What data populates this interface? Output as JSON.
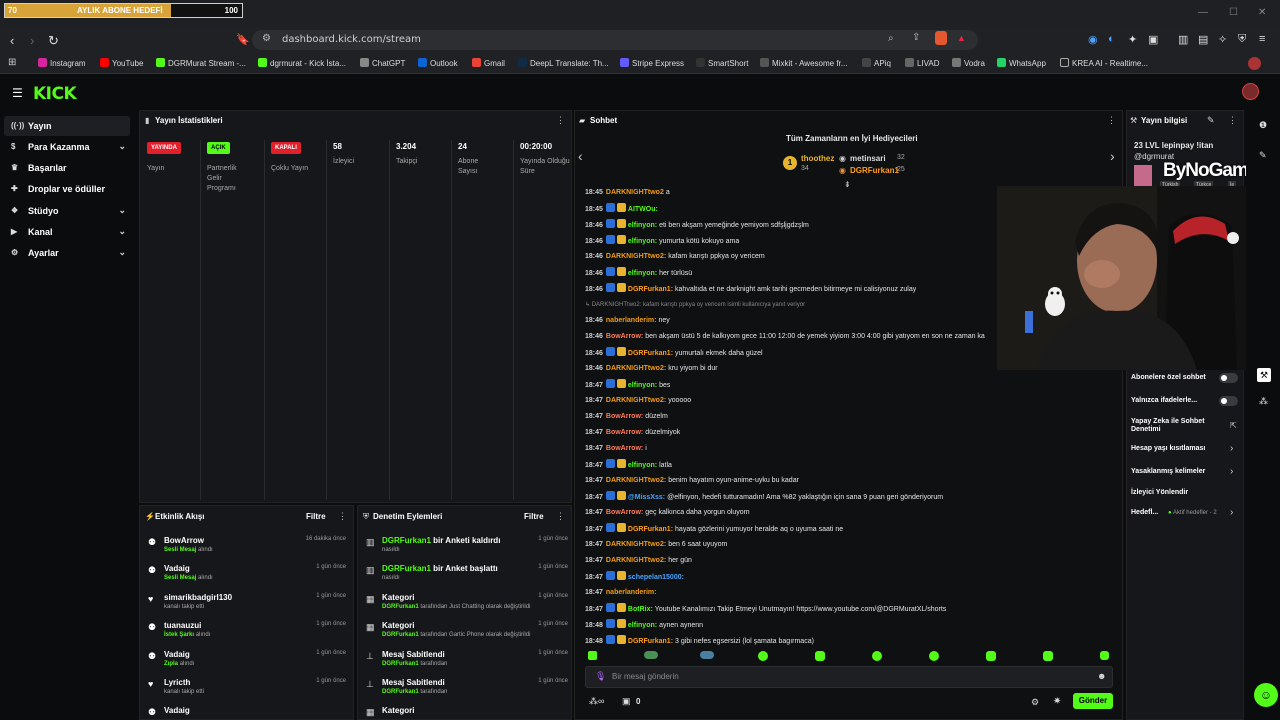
{
  "goal": {
    "start": "70",
    "title": "AYLIK ABONE HEDEFİ",
    "end": "100",
    "progress": 0.7,
    "fill_color": "#d8a43a"
  },
  "browser": {
    "url": "dashboard.kick.com/stream",
    "bookmarks": [
      "Instagram",
      "YouTube",
      "DGRMurat Stream -...",
      "dgrmurat - Kick İsta...",
      "ChatGPT",
      "Outlook",
      "Gmail",
      "DeepL Translate: Th...",
      "Stripe Express",
      "SmartShort",
      "Mixkit - Awesome fr...",
      "APiq",
      "LIVAD",
      "Vodra",
      "WhatsApp",
      "KREA AI - Realtime..."
    ]
  },
  "brand": {
    "logo": "KICK",
    "accent": "#53fc18"
  },
  "sidebar": {
    "items": [
      {
        "label": "Yayın",
        "icon": "broadcast-icon",
        "active": true
      },
      {
        "label": "Para Kazanma",
        "icon": "dollar-icon",
        "chevron": true
      },
      {
        "label": "Başarılar",
        "icon": "trophy-icon"
      },
      {
        "label": "Droplar ve ödüller",
        "icon": "gift-icon"
      },
      {
        "label": "Stüdyo",
        "icon": "studio-icon",
        "chevron": true
      },
      {
        "label": "Kanal",
        "icon": "channel-icon",
        "chevron": true
      },
      {
        "label": "Ayarlar",
        "icon": "gear-icon",
        "chevron": true
      }
    ]
  },
  "stats": {
    "title": "Yayın İstatistikleri",
    "cells": [
      {
        "badge": "YAYINDA",
        "badge_color": "#e2202b",
        "label": "Yayın"
      },
      {
        "badge": "AÇIK",
        "badge_color": "#53fc18",
        "label": "Partnerlik Gelir Programı"
      },
      {
        "badge": "KAPALI",
        "badge_color": "#e2202b",
        "label": "Çoklu Yayın"
      },
      {
        "value": "58",
        "label": "İzleyici"
      },
      {
        "value": "3.204",
        "label": "Takipçi"
      },
      {
        "value": "24",
        "label": "Abone Sayısı"
      },
      {
        "value": "00:20:00",
        "label": "Yayında Olduğu Süre"
      }
    ]
  },
  "activity": {
    "title": "Etkinlik Akışı",
    "filter": "Filtre",
    "items": [
      {
        "name": "BowArrow",
        "action": "Sesli Mesaj",
        "suffix": "alındı",
        "time": "16 dakika önce"
      },
      {
        "name": "Vadaig",
        "action": "Sesli Mesaj",
        "suffix": "alındı",
        "time": "1 gün önce"
      },
      {
        "name": "simarikbadgirl130",
        "action": "",
        "suffix": "kanalı takip etti",
        "time": "1 gün önce"
      },
      {
        "name": "tuanauzui",
        "action": "İstek Şarkı",
        "suffix": "alındı",
        "time": "1 gün önce"
      },
      {
        "name": "Vadaig",
        "action": "Zıpla",
        "suffix": "alındı",
        "time": "1 gün önce"
      },
      {
        "name": "Lyricth",
        "action": "",
        "suffix": "kanalı takip etti",
        "time": "1 gün önce"
      },
      {
        "name": "Vadaig",
        "action": "",
        "suffix": "",
        "time": ""
      }
    ]
  },
  "moderation": {
    "title": "Denetim Eylemleri",
    "filter": "Filtre",
    "items": [
      {
        "actor": "DGRFurkan1",
        "title": "bir Anketi kaldırdı",
        "sub_actor": "",
        "sub": "nasıldı",
        "time": "1 gün önce"
      },
      {
        "actor": "DGRFurkan1",
        "title": "bir Anket başlattı",
        "sub_actor": "",
        "sub": "nasıldı",
        "time": "1 gün önce"
      },
      {
        "actor": "",
        "title": "Kategori",
        "sub_actor": "DGRFurkan1",
        "sub": "tarafından Just Chatting olarak değiştirildi",
        "time": "1 gün önce"
      },
      {
        "actor": "",
        "title": "Kategori",
        "sub_actor": "DGRFurkan1",
        "sub": "tarafından Gartic Phone olarak değiştirildi",
        "time": "1 gün önce"
      },
      {
        "actor": "",
        "title": "Mesaj Sabitlendi",
        "sub_actor": "DGRFurkan1",
        "sub": "tarafından",
        "time": "1 gün önce"
      },
      {
        "actor": "",
        "title": "Mesaj Sabitlendi",
        "sub_actor": "DGRFurkan1",
        "sub": "tarafından",
        "time": "1 gün önce"
      },
      {
        "actor": "",
        "title": "Kategori",
        "sub_actor": "",
        "sub": "",
        "time": ""
      }
    ]
  },
  "chat": {
    "title": "Sohbet",
    "gifters_title": "Tüm Zamanların en İyi Hediyecileri",
    "gifters": [
      {
        "name": "thoothez",
        "count": "34"
      },
      {
        "name": "metinsari",
        "count": "32"
      },
      {
        "name": "DGRFurkan1",
        "count": "25"
      }
    ],
    "messages": [
      {
        "t": "18:45",
        "u": "DARKNIGHTtwo2",
        "c": "#f39c12",
        "m": "a"
      },
      {
        "t": "18:45",
        "u": "AITWOu:",
        "c": "#53fc18",
        "m": ""
      },
      {
        "t": "18:46",
        "u": "elfinyon:",
        "c": "#53fc18",
        "m": "eti ben akşam yemeğinde yemiyom sdfşljgdzşlm"
      },
      {
        "t": "18:46",
        "u": "elfinyon:",
        "c": "#53fc18",
        "m": "yumurta kötü kokuyo ama"
      },
      {
        "t": "18:46",
        "u": "DARKNIGHTtwo2:",
        "c": "#f39c12",
        "m": "kafam karıştı ppkya oy vericem"
      },
      {
        "t": "18:46",
        "u": "elfinyon:",
        "c": "#53fc18",
        "m": "her türlüsü"
      },
      {
        "t": "18:46",
        "u": "DGRFurkan1:",
        "c": "#ff9f1c",
        "m": "kahvaltıda et ne darknight amk tarihi gecmeden bitirmeye mi calisiyonuz zulay"
      },
      {
        "t": "",
        "u": "",
        "c": "#888",
        "m": "↳ DARKNIGHTtwo2: kafam karıştı ppkya oy vericem isimli kullanıcıya yanıt veriyor",
        "reply": true
      },
      {
        "t": "18:46",
        "u": "naberlanderim:",
        "c": "#f39c12",
        "m": "ney"
      },
      {
        "t": "18:46",
        "u": "BowArrow:",
        "c": "#ff7a5c",
        "m": "ben akşam üstü 5 de kalkıyom gece 11:00 12:00 de yemek yiyiom 3:00 4:00 gibi yatıyom en son ne zaman ka"
      },
      {
        "t": "18:46",
        "u": "DGRFurkan1:",
        "c": "#ff9f1c",
        "m": "yumurtalı ekmek daha güzel"
      },
      {
        "t": "18:46",
        "u": "DARKNIGHTtwo2:",
        "c": "#f39c12",
        "m": "kru yiyom bi dur"
      },
      {
        "t": "18:47",
        "u": "elfinyon:",
        "c": "#53fc18",
        "m": "bes"
      },
      {
        "t": "18:47",
        "u": "DARKNIGHTtwo2:",
        "c": "#f39c12",
        "m": "yooooo"
      },
      {
        "t": "18:47",
        "u": "BowArrow:",
        "c": "#ff7a5c",
        "m": "düzelm"
      },
      {
        "t": "18:47",
        "u": "BowArrow:",
        "c": "#ff7a5c",
        "m": "düzelmiyok"
      },
      {
        "t": "18:47",
        "u": "BowArrow:",
        "c": "#ff7a5c",
        "m": "i"
      },
      {
        "t": "18:47",
        "u": "elfinyon:",
        "c": "#53fc18",
        "m": "latla"
      },
      {
        "t": "18:47",
        "u": "DARKNIGHTtwo2:",
        "c": "#f39c12",
        "m": "benim hayatım oyun-anime-uyku bu kadar"
      },
      {
        "t": "18:47",
        "u": "@MissXss:",
        "c": "#4aa3ff",
        "m": "@elfinyon, hedefi tutturamadın! Ama %82 yaklaştığın için sana 9 puan geri gönderiyorum"
      },
      {
        "t": "18:47",
        "u": "BowArrow:",
        "c": "#ff7a5c",
        "m": "geç kalkınca daha yorgun oluyom"
      },
      {
        "t": "18:47",
        "u": "DGRFurkan1:",
        "c": "#ff9f1c",
        "m": "hayata gözlerini yumuyor heralde aq o uyuma saati ne"
      },
      {
        "t": "18:47",
        "u": "DARKNIGHTtwo2:",
        "c": "#f39c12",
        "m": "ben 6 saat uyuyom"
      },
      {
        "t": "18:47",
        "u": "DARKNIGHTtwo2:",
        "c": "#f39c12",
        "m": "her gün"
      },
      {
        "t": "18:47",
        "u": "schepelan15000:",
        "c": "#4aa3ff",
        "m": ""
      },
      {
        "t": "18:47",
        "u": "naberlanderim:",
        "c": "#f39c12",
        "m": ""
      },
      {
        "t": "18:47",
        "u": "BotRix:",
        "c": "#53fc18",
        "m": "Youtube Kanalımızı Takip Etmeyi Unutmayın! https://www.youtube.com/@DGRMuratXL/shorts"
      },
      {
        "t": "18:48",
        "u": "elfinyon:",
        "c": "#53fc18",
        "m": "aynen aynenn"
      },
      {
        "t": "18:48",
        "u": "DGRFurkan1:",
        "c": "#ff9f1c",
        "m": "3 gibi nefes egsersizi (lol şamata bagırmaca)"
      }
    ],
    "input_placeholder": "Bir mesaj gönderin",
    "points": "0",
    "send": "Gönder"
  },
  "info": {
    "title": "Yayın bilgisi",
    "stream_title": "23 LVL lepinpay !itan",
    "handle": "@dgrmurat",
    "tags": [
      "Türkish",
      "Türkçe",
      "İe"
    ],
    "watermark": "ByNoGame",
    "rows": [
      {
        "label": "Abonelere özel sohbet",
        "type": "toggle"
      },
      {
        "label": "Yalnızca ifadelerle...",
        "type": "toggle"
      },
      {
        "label": "Yapay Zeka ile Sohbet Denetimi",
        "type": "link"
      },
      {
        "label": "Hesap yaşı kısıtlaması",
        "type": "chev"
      },
      {
        "label": "Yasaklanmış kelimeler",
        "type": "chev"
      },
      {
        "label": "İzleyici Yönlendir",
        "type": "none"
      },
      {
        "label": "Hedefl...",
        "extra": "Aktif hedefler - 2",
        "type": "chev"
      }
    ]
  }
}
